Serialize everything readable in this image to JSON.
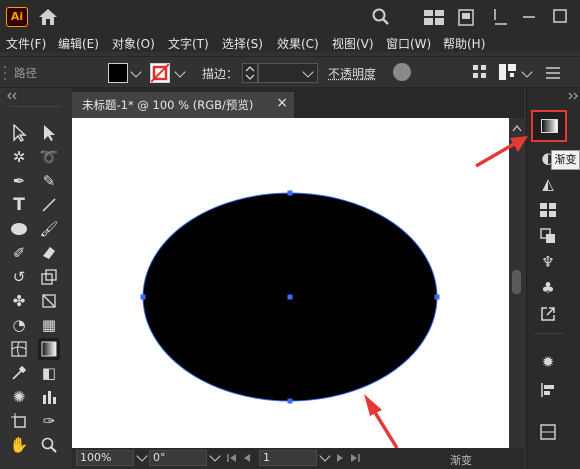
{
  "app": {
    "logo_text": "Ai"
  },
  "menu": {
    "items": [
      "文件(F)",
      "编辑(E)",
      "对象(O)",
      "文字(T)",
      "选择(S)",
      "效果(C)",
      "视图(V)",
      "窗口(W)",
      "帮助(H)"
    ]
  },
  "control_bar": {
    "path_label": "路径",
    "fill_color": "#000000",
    "stroke_label": "描边：",
    "opacity_label": "不透明度"
  },
  "document": {
    "tab_title": "未标题-1* @ 100 % (RGB/预览)",
    "close_glyph": "×"
  },
  "artwork": {
    "shape": "ellipse",
    "fill": "#000000",
    "selection_color": "#3b6ef5"
  },
  "status_bar": {
    "zoom": "100%",
    "rotation": "0°",
    "artboard": "1"
  },
  "panels": {
    "tooltip": "渐变",
    "bottom_label": "渐变",
    "highlight_color": "#e53935"
  },
  "annotation": {
    "arrow_color": "#e53935"
  }
}
